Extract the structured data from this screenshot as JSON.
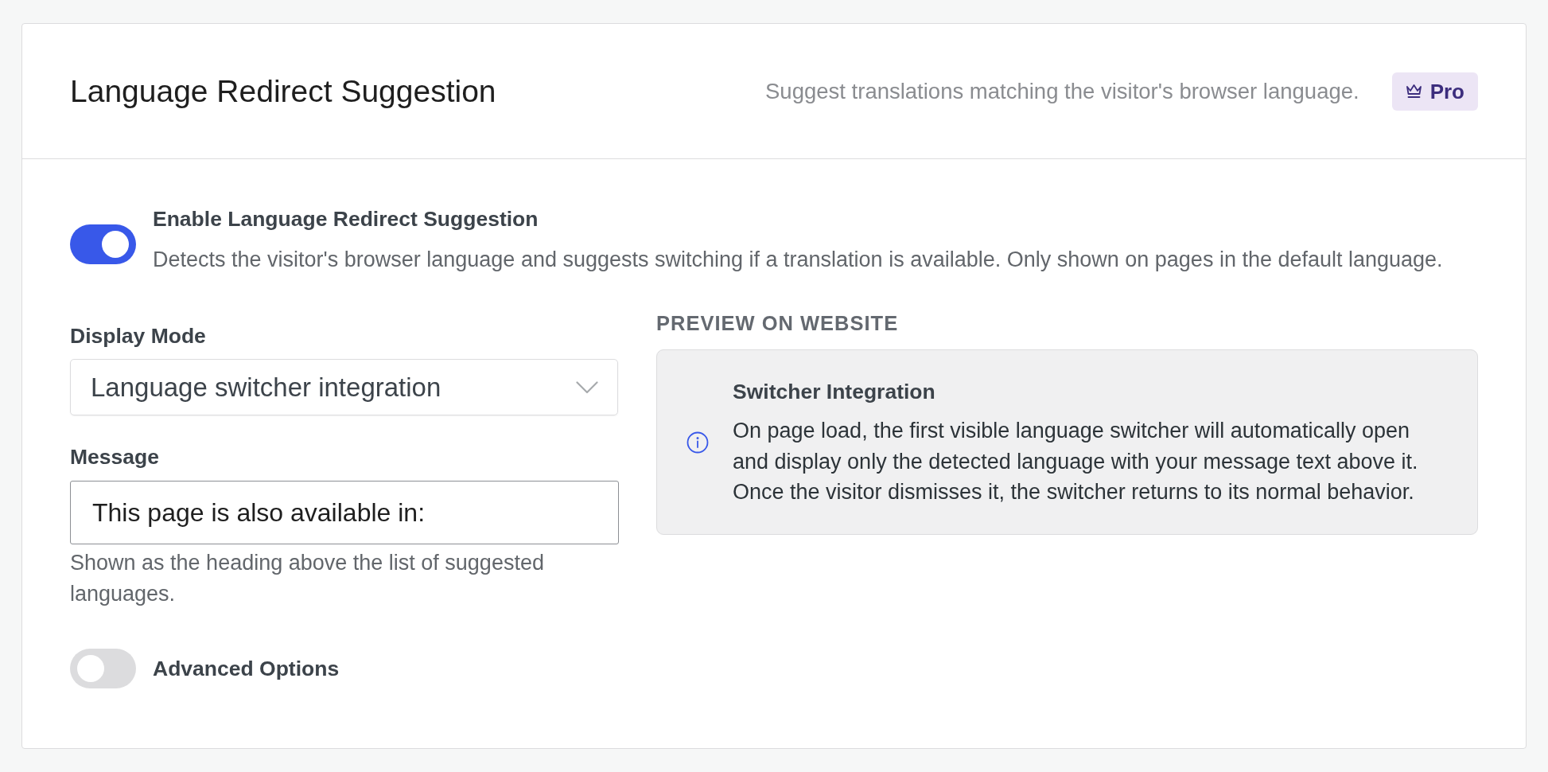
{
  "header": {
    "title": "Language Redirect Suggestion",
    "subtitle": "Suggest translations matching the visitor's browser language.",
    "badge": "Pro"
  },
  "enable": {
    "label": "Enable Language Redirect Suggestion",
    "description": "Detects the visitor's browser language and suggests switching if a translation is available. Only shown on pages in the default language.",
    "on": true
  },
  "display_mode": {
    "label": "Display Mode",
    "value": "Language switcher integration"
  },
  "message": {
    "label": "Message",
    "value": "This page is also available in:",
    "help": "Shown as the heading above the list of suggested languages."
  },
  "advanced": {
    "label": "Advanced Options",
    "on": false
  },
  "preview": {
    "heading": "PREVIEW ON WEBSITE",
    "title": "Switcher Integration",
    "text": "On page load, the first visible language switcher will automatically open and display only the detected language with your message text above it. Once the visitor dismisses it, the switcher returns to its normal behavior."
  }
}
